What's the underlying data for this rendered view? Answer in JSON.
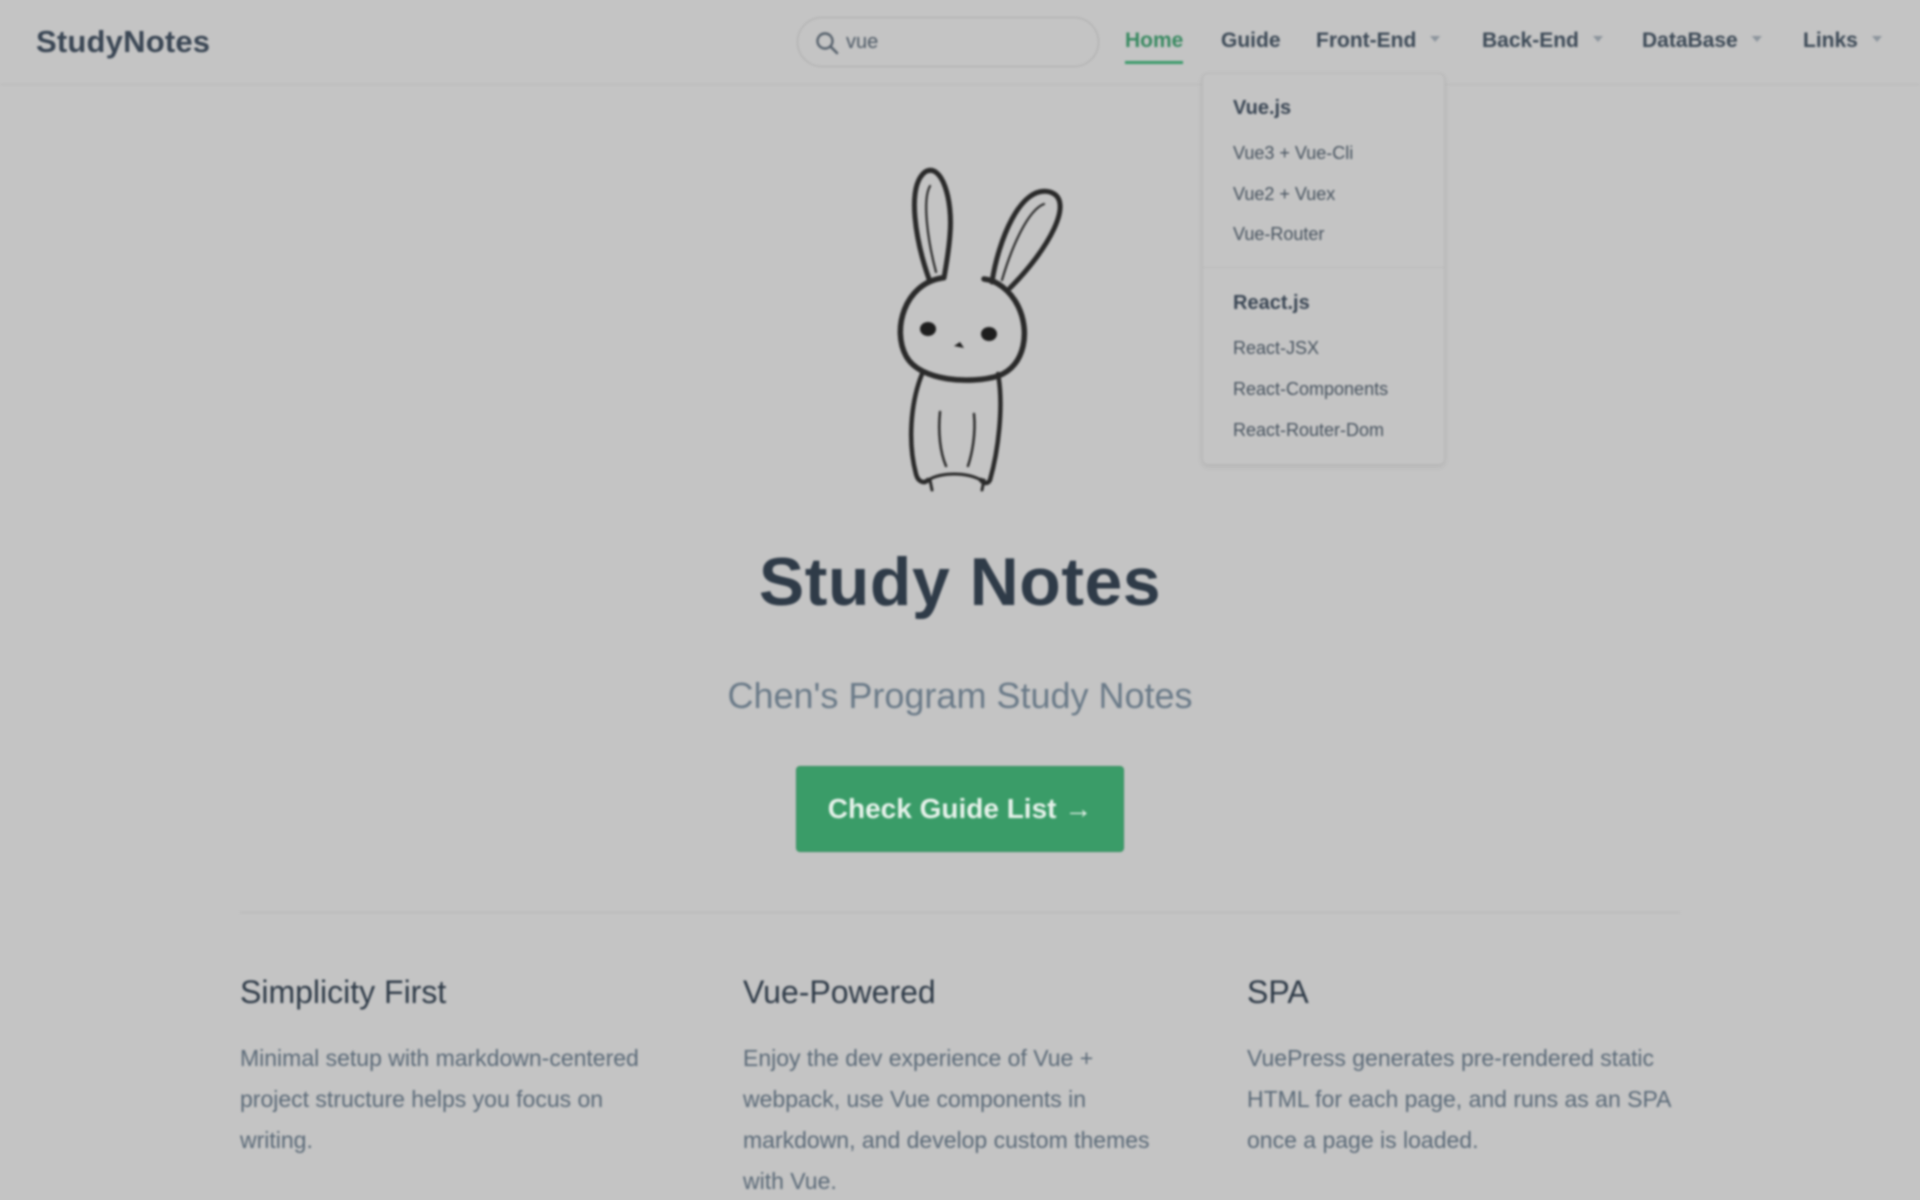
{
  "navbar": {
    "site_name": "StudyNotes",
    "search": {
      "value": "vue",
      "placeholder": ""
    },
    "links": [
      {
        "label": "Home",
        "active": true
      },
      {
        "label": "Guide"
      },
      {
        "label": "Front-End",
        "dropdown": true
      },
      {
        "label": "Back-End",
        "dropdown": true
      },
      {
        "label": "DataBase",
        "dropdown": true
      },
      {
        "label": "Links",
        "dropdown": true
      }
    ]
  },
  "dropdown": {
    "groups": [
      {
        "title": "Vue.js",
        "items": [
          "Vue3 + Vue-Cli",
          "Vue2 + Vuex",
          "Vue-Router"
        ]
      },
      {
        "title": "React.js",
        "items": [
          "React-JSX",
          "React-Components",
          "React-Router-Dom"
        ]
      }
    ]
  },
  "hero": {
    "image": "bunny-illustration",
    "title": "Study Notes",
    "tagline": "Chen's Program Study Notes",
    "action_label": "Check Guide List →"
  },
  "features": [
    {
      "title": "Simplicity First",
      "details": "Minimal setup with markdown-centered project structure helps you focus on writing."
    },
    {
      "title": "Vue-Powered",
      "details": "Enjoy the dev experience of Vue + webpack, use Vue components in markdown, and develop custom themes with Vue."
    },
    {
      "title": "SPA",
      "details": "VuePress generates pre-rendered static HTML for each page, and runs as an SPA once a page is loaded."
    }
  ],
  "colors": {
    "accent": "#3a9c68",
    "overlay_background": "#c4c4c4"
  }
}
